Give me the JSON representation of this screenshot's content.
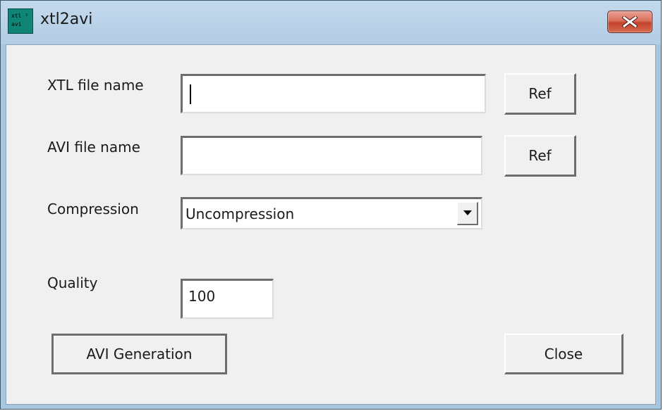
{
  "window": {
    "title": "xtl2avi",
    "icon": "app-icon",
    "icon_glyph": "xtl ²\navi",
    "close_icon": "close-icon"
  },
  "form": {
    "xtl_label": "XTL file name",
    "xtl_value": "",
    "avi_label": "AVI file name",
    "avi_value": "",
    "compression_label": "Compression",
    "compression_value": "Uncompression",
    "quality_label": "Quality",
    "quality_value": "100"
  },
  "buttons": {
    "ref_xtl": "Ref",
    "ref_avi": "Ref",
    "generate": "AVI Generation",
    "close": "Close"
  },
  "colors": {
    "app_icon_bg": "#0f8577",
    "close_button_red": "#c2432c",
    "dialog_bg": "#f0f0f0"
  }
}
